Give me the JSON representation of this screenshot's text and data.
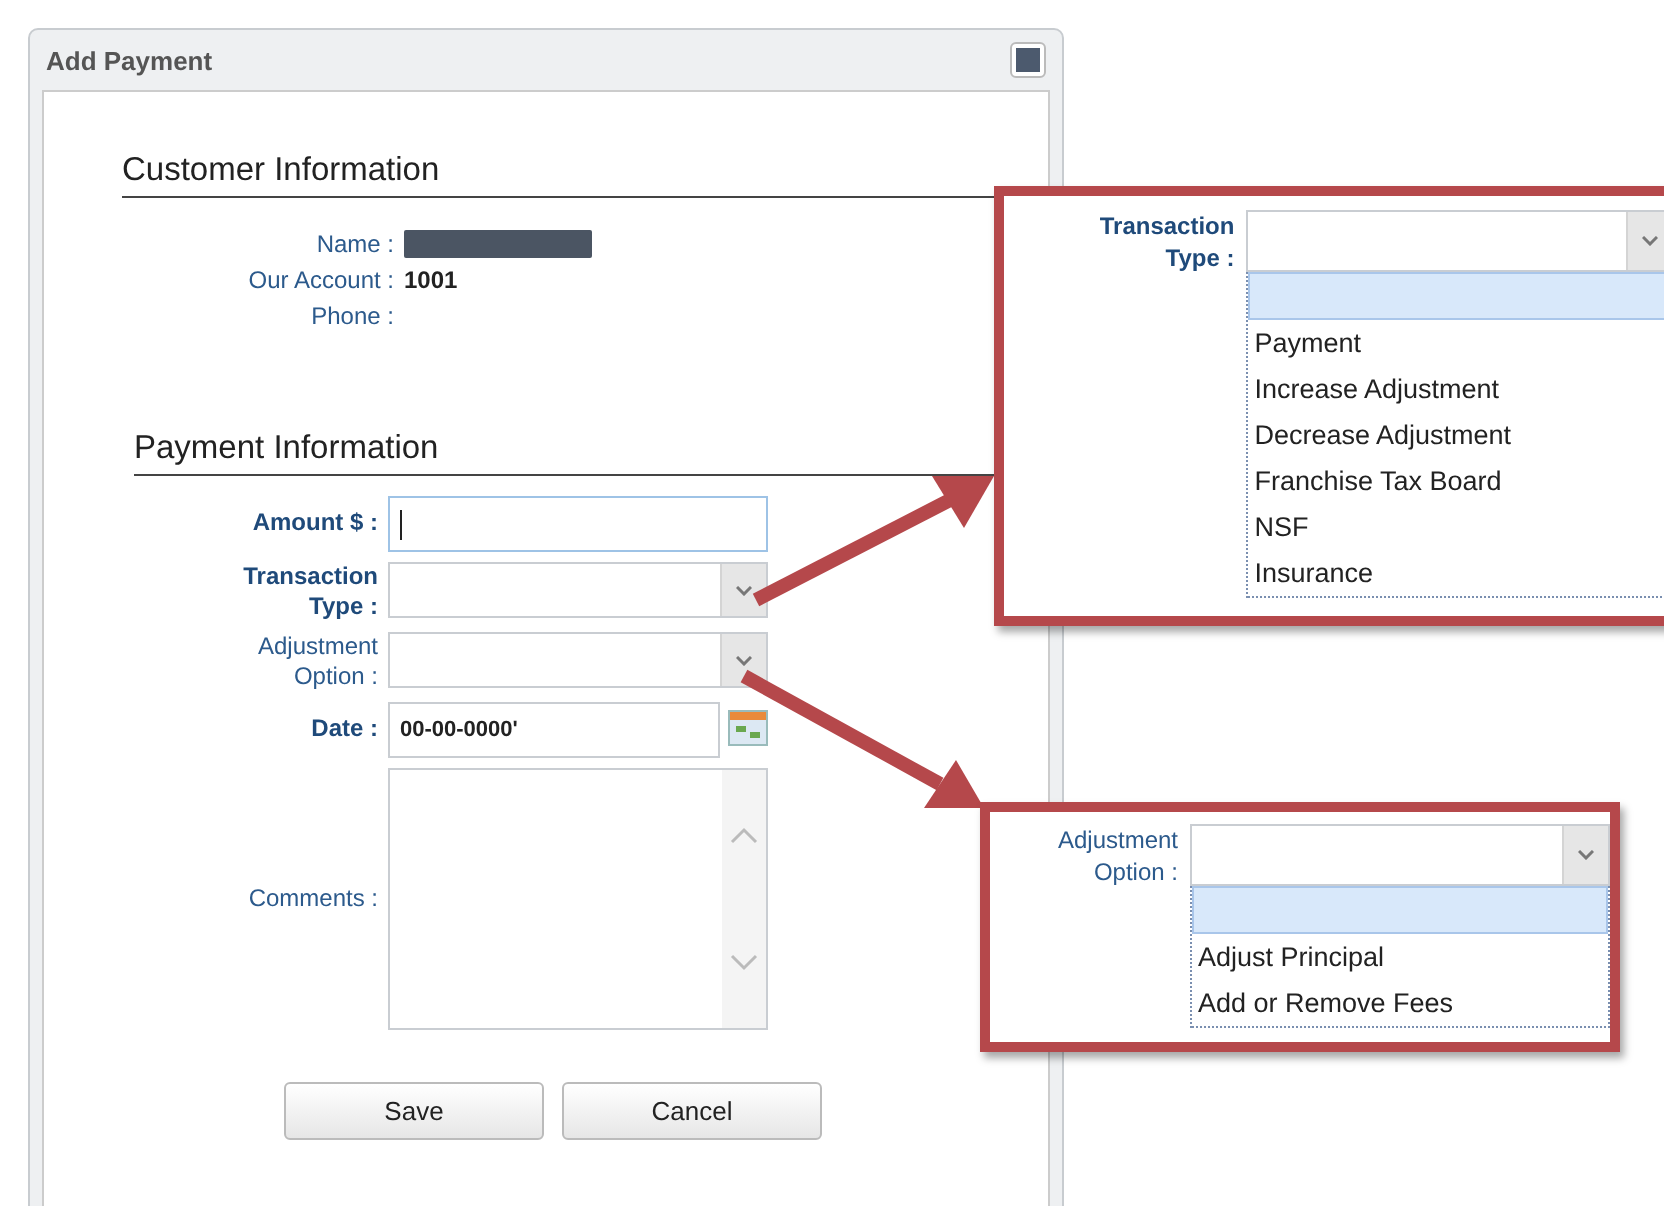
{
  "dialog": {
    "title": "Add Payment"
  },
  "customer_section": {
    "heading": "Customer Information",
    "fields": [
      {
        "label": "Name :",
        "redacted": true
      },
      {
        "label": "Our Account :",
        "value": "1001",
        "redacted": false
      },
      {
        "label": "Phone :",
        "redacted": false
      }
    ]
  },
  "payment_section": {
    "heading": "Payment Information",
    "fields": [
      {
        "kind": "text",
        "label": "Amount $ :",
        "bold": true,
        "focused": true
      },
      {
        "kind": "select",
        "label": "Transaction Type :",
        "bold": true
      },
      {
        "kind": "select",
        "label": "Adjustment Option :",
        "bold": false
      },
      {
        "kind": "date",
        "label": "Date :",
        "bold": true,
        "value": "00-00-0000'"
      },
      {
        "kind": "textarea",
        "label": "Comments :",
        "bold": false
      }
    ]
  },
  "buttons": [
    "Save",
    "Cancel"
  ],
  "callouts": [
    {
      "label": "Transaction Type :",
      "bold": true,
      "blank_option_highlighted": true,
      "options": [
        "Payment",
        "Increase Adjustment",
        "Decrease Adjustment",
        "Franchise Tax Board",
        "NSF",
        "Insurance"
      ]
    },
    {
      "label": "Adjustment Option :",
      "bold": false,
      "blank_option_highlighted": true,
      "options": [
        "Adjust Principal",
        "Add or Remove Fees"
      ]
    }
  ]
}
